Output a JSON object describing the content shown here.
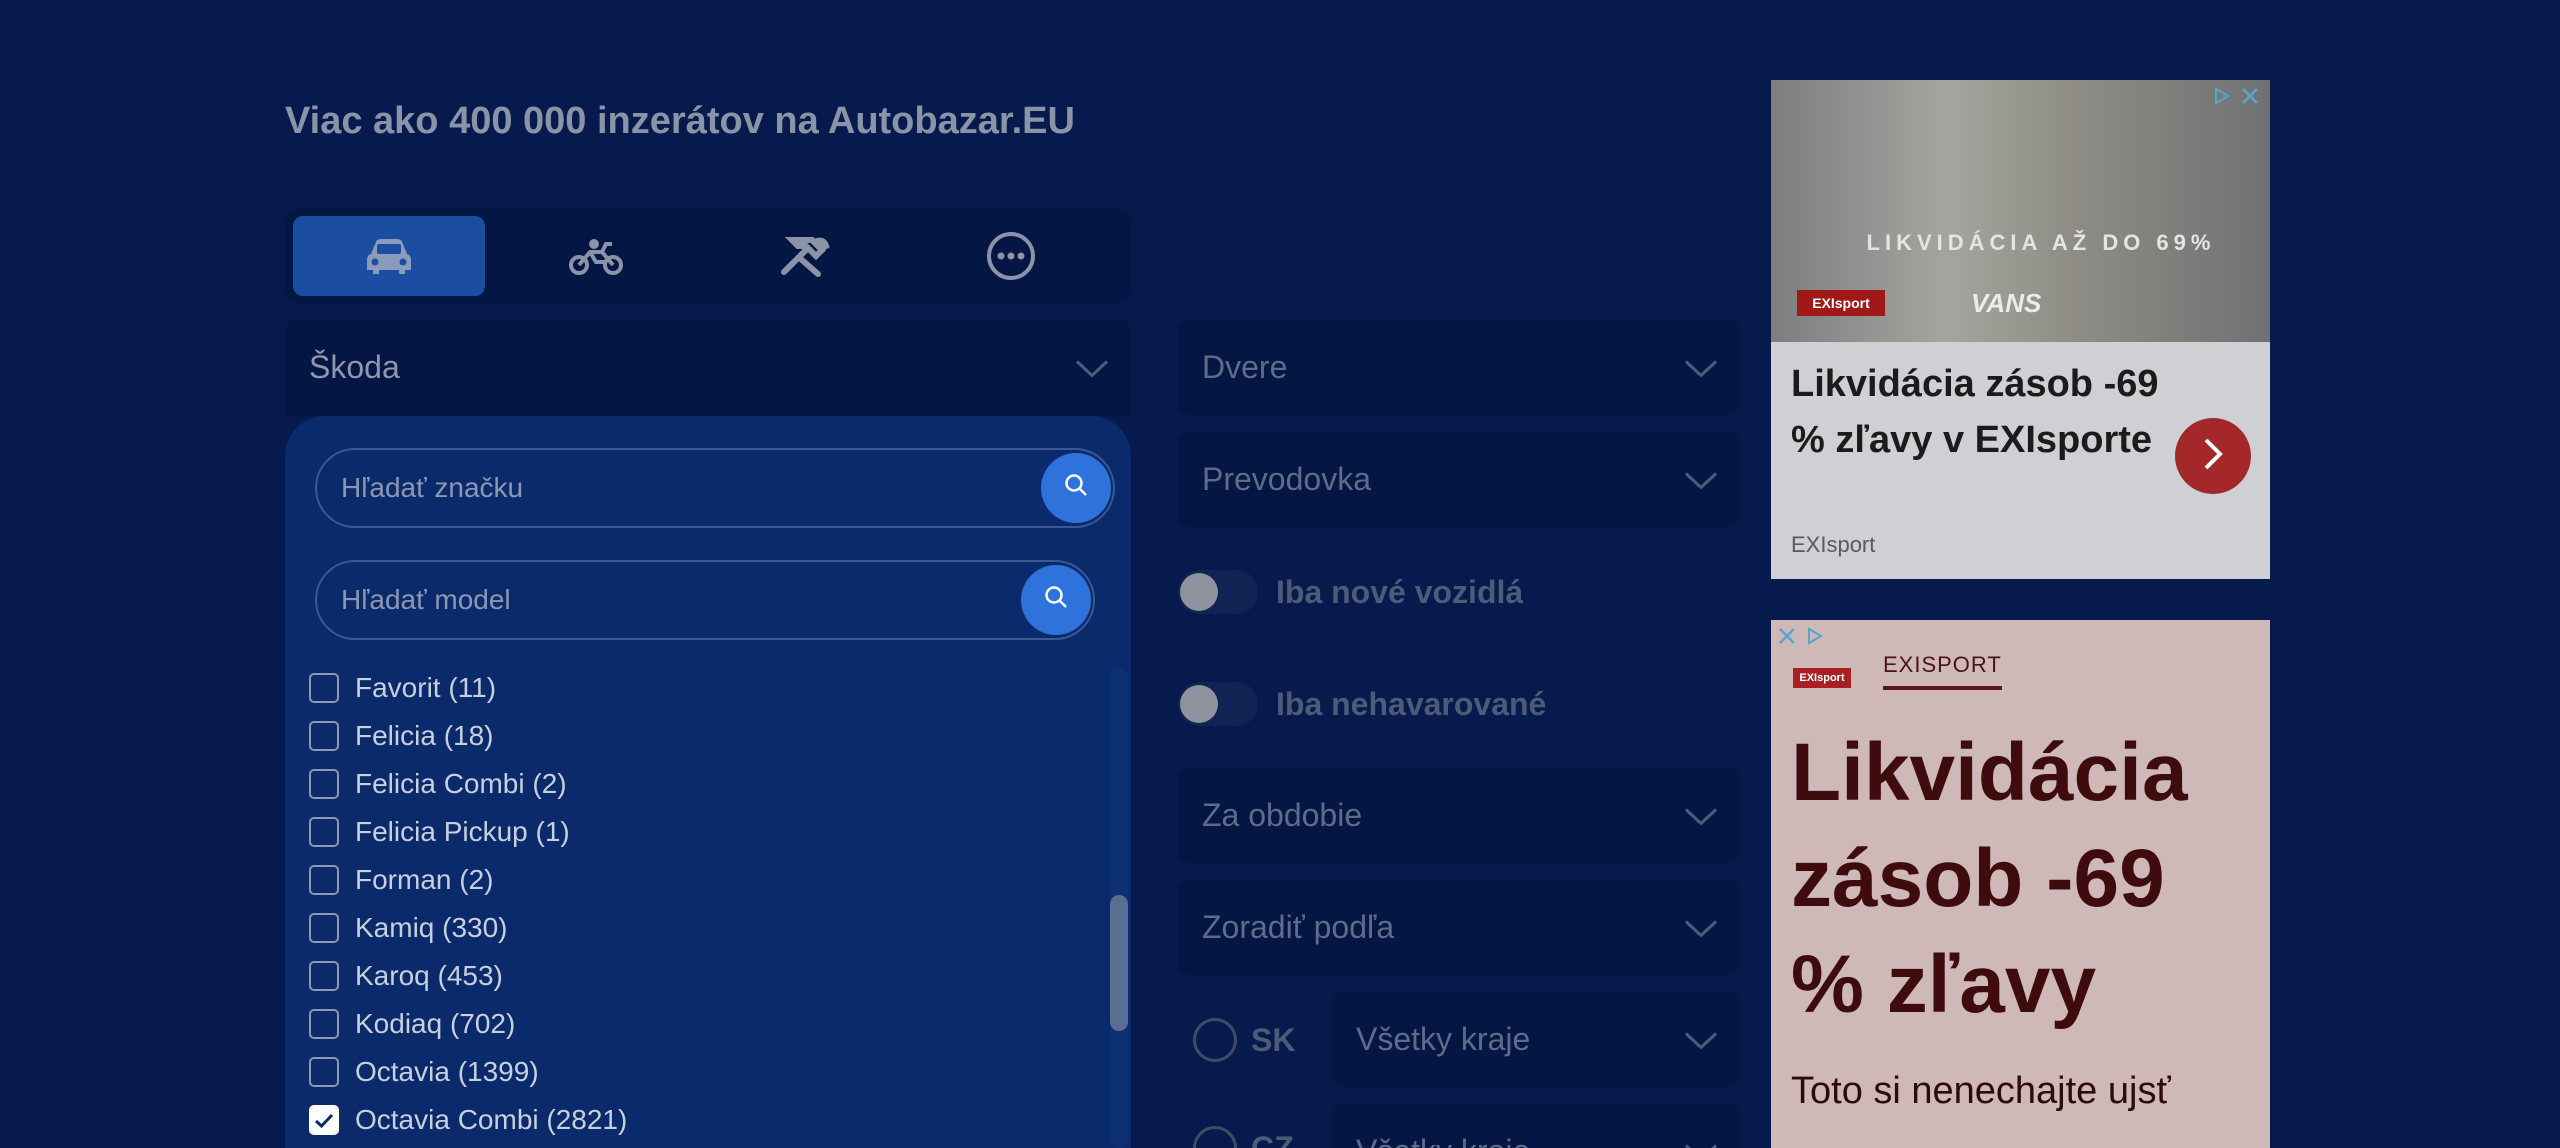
{
  "headline": "Viac ako 400 000 inzerátov na Autobazar.EU",
  "tabs": [
    {
      "icon": "car-icon",
      "active": true
    },
    {
      "icon": "motorcycle-icon",
      "active": false
    },
    {
      "icon": "tools-icon",
      "active": false
    },
    {
      "icon": "more-icon",
      "active": false
    }
  ],
  "brand_select": {
    "value": "Škoda"
  },
  "brand_search": {
    "placeholder": "Hľadať značku"
  },
  "model_search": {
    "placeholder": "Hľadať model"
  },
  "models": [
    {
      "label": "Favorit (11)",
      "checked": false
    },
    {
      "label": "Felicia (18)",
      "checked": false
    },
    {
      "label": "Felicia Combi (2)",
      "checked": false
    },
    {
      "label": "Felicia Pickup (1)",
      "checked": false
    },
    {
      "label": "Forman (2)",
      "checked": false
    },
    {
      "label": "Kamiq (330)",
      "checked": false
    },
    {
      "label": "Karoq (453)",
      "checked": false
    },
    {
      "label": "Kodiaq (702)",
      "checked": false
    },
    {
      "label": "Octavia (1399)",
      "checked": false
    },
    {
      "label": "Octavia Combi (2821)",
      "checked": true
    }
  ],
  "filters": {
    "doors": "Dvere",
    "gearbox": "Prevodovka",
    "only_new": "Iba nové vozidlá",
    "only_undamaged": "Iba nehavarované",
    "period": "Za obdobie",
    "sort": "Zoradiť podľa",
    "country_sk": "SK",
    "country_cz": "CZ",
    "region_sk": "Všetky kraje",
    "region_cz": "Všetky kraje"
  },
  "ad1": {
    "promo": "LIKVIDÁCIA AŽ DO 69%",
    "logo": "EXIsport",
    "brand": "VANS",
    "title": "Likvidácia zásob -69 % zľavy v EXIsporte",
    "source": "EXIsport"
  },
  "ad2": {
    "logo": "EXIsport",
    "tab": "EXISPORT",
    "title": "Likvidácia zásob -69 % zľavy",
    "subtitle": "Toto si nenechajte ujsť"
  },
  "colors": {
    "background": "#061a4d",
    "accent": "#2d73db",
    "panel": "#0a2a6c"
  }
}
